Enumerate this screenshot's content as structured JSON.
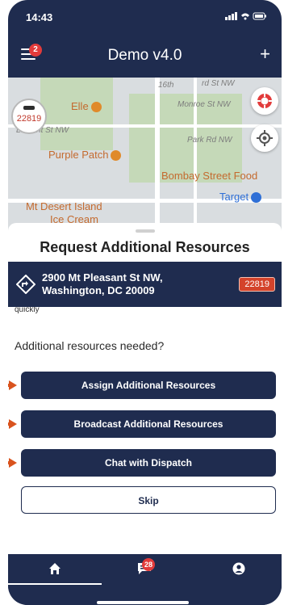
{
  "status_bar": {
    "time": "14:43",
    "indicators": "signal wifi battery"
  },
  "nav": {
    "menu_badge": "2",
    "title": "Demo v4.0",
    "plus_label": "+"
  },
  "map": {
    "labels": {
      "elle": "Elle",
      "purple_patch": "Purple Patch",
      "bombay": "Bombay Street Food",
      "target": "Target",
      "mt_desert": "Mt Desert Island",
      "ice_cream": "Ice Cream",
      "monroe": "Monroe St NW",
      "lamont": "Lamont St NW",
      "park_rd": "Park Rd NW",
      "harvard": "rd St NW",
      "st16": "16th"
    },
    "incident_marker": "22819"
  },
  "sheet": {
    "title": "Request Additional Resources",
    "address": {
      "line1": "2900 Mt Pleasant St NW,",
      "line2": "Washington, DC 20009",
      "incident_number": "22819"
    },
    "cut_text": "quickly",
    "question": "Additional resources needed?",
    "buttons": {
      "assign": "Assign Additional Resources",
      "broadcast": "Broadcast Additional Resources",
      "chat": "Chat with Dispatch",
      "skip": "Skip"
    }
  },
  "tabbar": {
    "messages_badge": "28"
  },
  "colors": {
    "navy": "#1f2c4f",
    "red_badge": "#e23b3b",
    "incident_red": "#d4432b",
    "arrow": "#d9531e"
  }
}
